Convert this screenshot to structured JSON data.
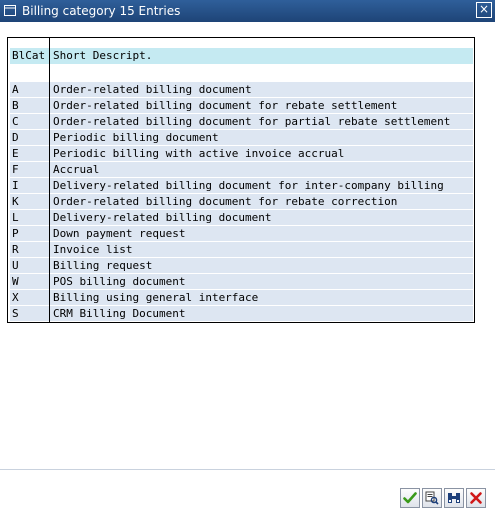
{
  "window": {
    "title": "Billing category 15 Entries",
    "close_glyph": "×"
  },
  "table": {
    "columns": [
      "BlCat",
      "Short Descript."
    ],
    "rows": [
      {
        "code": "A",
        "desc": "Order-related billing document"
      },
      {
        "code": "B",
        "desc": "Order-related billing document for rebate settlement"
      },
      {
        "code": "C",
        "desc": "Order-related billing document for partial rebate settlement"
      },
      {
        "code": "D",
        "desc": "Periodic billing document"
      },
      {
        "code": "E",
        "desc": "Periodic billing with active invoice accrual"
      },
      {
        "code": "F",
        "desc": "Accrual"
      },
      {
        "code": "I",
        "desc": "Delivery-related billing document for inter-company billing"
      },
      {
        "code": "K",
        "desc": "Order-related billing document for rebate correction"
      },
      {
        "code": "L",
        "desc": "Delivery-related billing document"
      },
      {
        "code": "P",
        "desc": "Down payment request"
      },
      {
        "code": "R",
        "desc": "Invoice list"
      },
      {
        "code": "U",
        "desc": "Billing request"
      },
      {
        "code": "W",
        "desc": "POS billing document"
      },
      {
        "code": "X",
        "desc": "Billing using general interface"
      },
      {
        "code": "S",
        "desc": "CRM Billing Document"
      }
    ]
  },
  "toolbar": {
    "buttons": [
      {
        "name": "confirm-button",
        "icon": "checkmark-icon"
      },
      {
        "name": "find-button",
        "icon": "find-icon"
      },
      {
        "name": "find-next-button",
        "icon": "binoculars-icon"
      },
      {
        "name": "cancel-button",
        "icon": "cancel-x-icon"
      }
    ]
  },
  "colors": {
    "title_bar": "#1e4477",
    "header_row": "#c5eaf2",
    "data_row": "#dde6f2",
    "confirm_green": "#3a9a1a",
    "cancel_red": "#d01818"
  }
}
